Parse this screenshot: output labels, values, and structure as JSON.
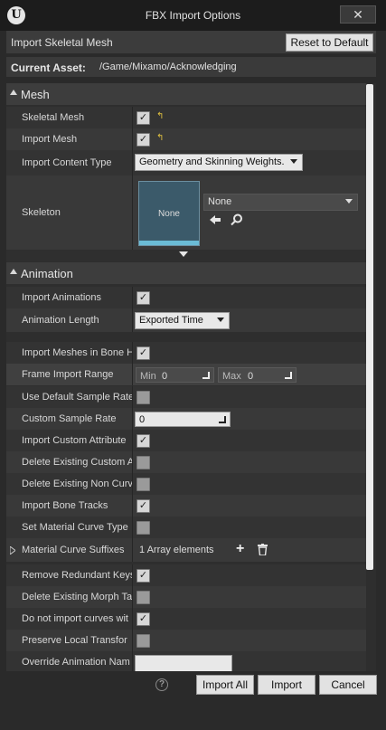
{
  "window": {
    "title": "FBX Import Options",
    "close_glyph": "✕",
    "logo_glyph": "U"
  },
  "header": {
    "section_label": "Import Skeletal Mesh",
    "reset_button": "Reset to Default"
  },
  "current_asset": {
    "label": "Current Asset:",
    "path": "/Game/Mixamo/Acknowledging"
  },
  "mesh": {
    "title": "Mesh",
    "skeletal_mesh": "Skeletal Mesh",
    "import_mesh": "Import Mesh",
    "import_content_type": "Import Content Type",
    "content_type_value": "Geometry and Skinning Weights.",
    "skeleton": "Skeleton",
    "skeleton_thumb_label": "None",
    "skeleton_value": "None"
  },
  "animation": {
    "title": "Animation",
    "rows": {
      "import_animations": "Import Animations",
      "animation_length": "Animation Length",
      "animation_length_value": "Exported Time",
      "import_meshes_bone": "Import Meshes in Bone H",
      "frame_import_range": "Frame Import Range",
      "min_label": "Min",
      "min_value": "0",
      "max_label": "Max",
      "max_value": "0",
      "use_default_sample_rate": "Use Default Sample Rate",
      "custom_sample_rate": "Custom Sample Rate",
      "custom_sample_rate_value": "0",
      "import_custom_attribute": "Import Custom Attribute",
      "delete_existing_custom": "Delete Existing Custom A",
      "delete_existing_non_curve": "Delete Existing Non Curv",
      "import_bone_tracks": "Import Bone Tracks",
      "set_material_curve_type": "Set Material Curve Type",
      "material_curve_suffixes": "Material Curve Suffixes",
      "array_elements": "1 Array elements",
      "remove_redundant_keys": "Remove Redundant Keys",
      "delete_existing_morph": "Delete Existing Morph Ta",
      "do_not_import_curves": "Do not import curves wit",
      "preserve_local_transform": "Preserve Local Transfor",
      "override_animation_name": "Override Animation Nam"
    }
  },
  "footer": {
    "help_glyph": "?",
    "import_all": "Import All",
    "import": "Import",
    "cancel": "Cancel"
  },
  "check_glyph": "✓",
  "reset_glyph": "↰"
}
